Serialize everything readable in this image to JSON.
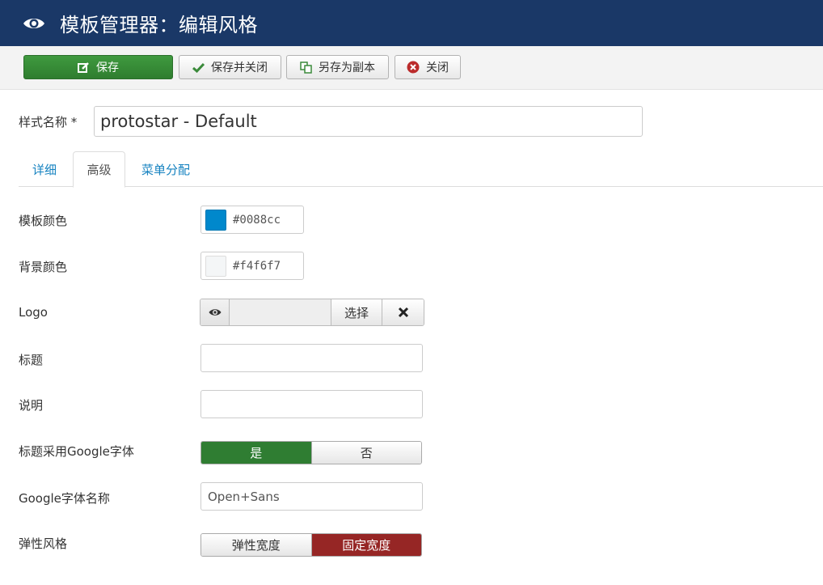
{
  "header": {
    "title": "模板管理器：编辑风格",
    "icon": "eye-icon"
  },
  "toolbar": {
    "save": "保存",
    "save_close": "保存并关闭",
    "save_copy": "另存为副本",
    "close": "关闭"
  },
  "style_name": {
    "label": "样式名称 *",
    "value": "protostar - Default"
  },
  "tabs": [
    {
      "label": "详细"
    },
    {
      "label": "高级",
      "active": true
    },
    {
      "label": "菜单分配"
    }
  ],
  "fields": {
    "template_color": {
      "label": "模板颜色",
      "value": "#0088cc"
    },
    "background_color": {
      "label": "背景颜色",
      "value": "#f4f6f7"
    },
    "logo": {
      "label": "Logo",
      "select": "选择"
    },
    "title": {
      "label": "标题",
      "value": ""
    },
    "description": {
      "label": "说明",
      "value": ""
    },
    "google_font": {
      "label": "标题采用Google字体",
      "yes": "是",
      "no": "否",
      "selected": "是"
    },
    "google_font_name": {
      "label": "Google字体名称",
      "value": "Open+Sans"
    },
    "fluid_layout": {
      "label": "弹性风格",
      "fluid": "弹性宽度",
      "static": "固定宽度",
      "selected": "固定宽度"
    }
  },
  "colors": {
    "header_bg": "#1a3867",
    "save_green": "#2f7d2f",
    "toggle_green": "#2f7d32",
    "toggle_red": "#962625",
    "link": "#1582c0"
  }
}
